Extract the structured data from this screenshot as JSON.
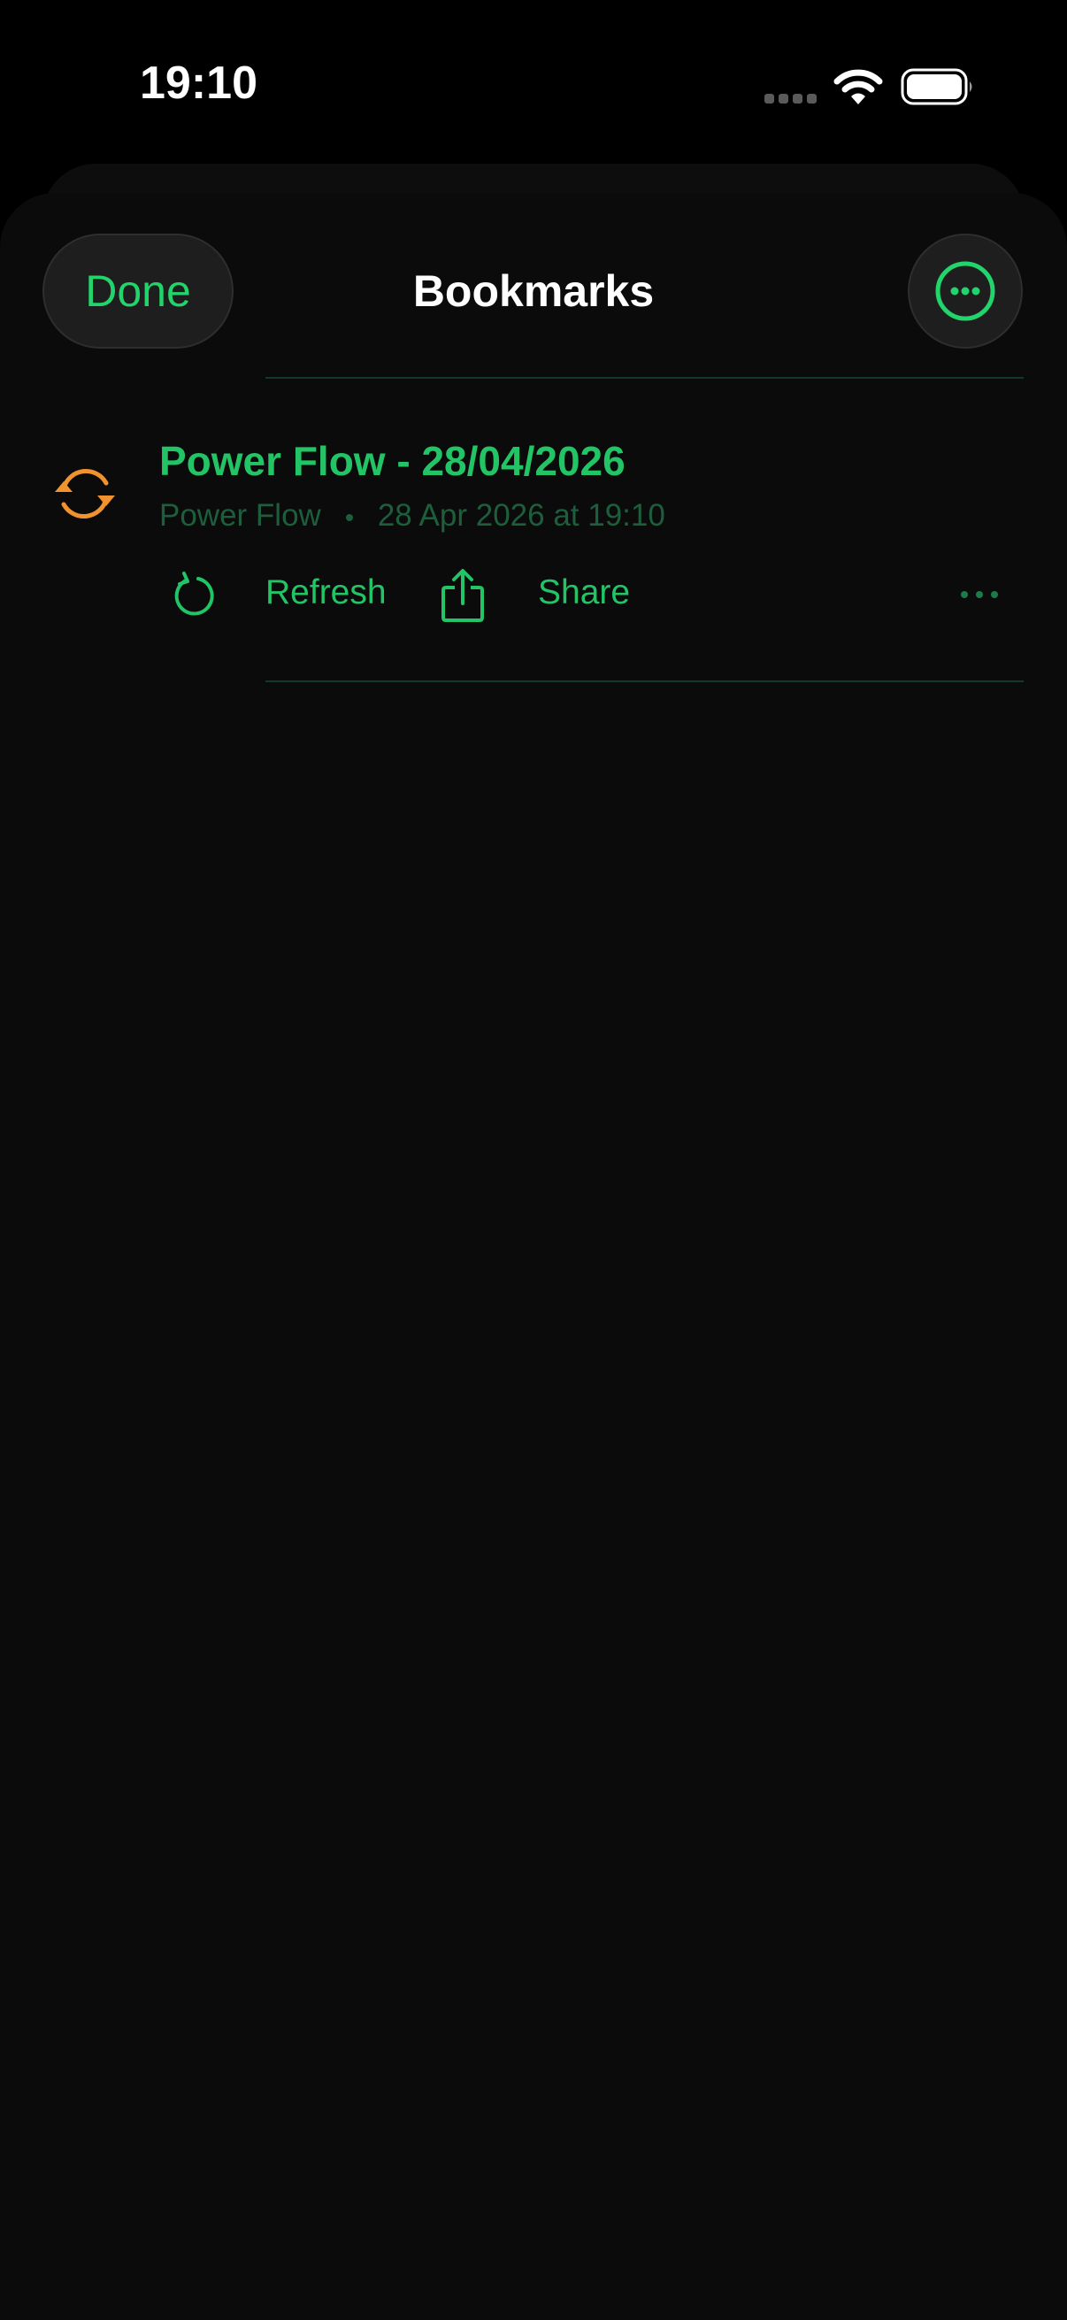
{
  "status_bar": {
    "time": "19:10"
  },
  "nav": {
    "done_label": "Done",
    "title": "Bookmarks"
  },
  "bookmark": {
    "title": "Power Flow - 28/04/2026",
    "subtitle_app": "Power Flow",
    "subtitle_date": "28 Apr 2026 at 19:10",
    "icon": "sync-arrows-icon",
    "actions": {
      "refresh_label": "Refresh",
      "share_label": "Share"
    }
  },
  "colors": {
    "accent_green": "#22c466",
    "icon_orange": "#f0922e",
    "background": "#0b0b0b"
  }
}
